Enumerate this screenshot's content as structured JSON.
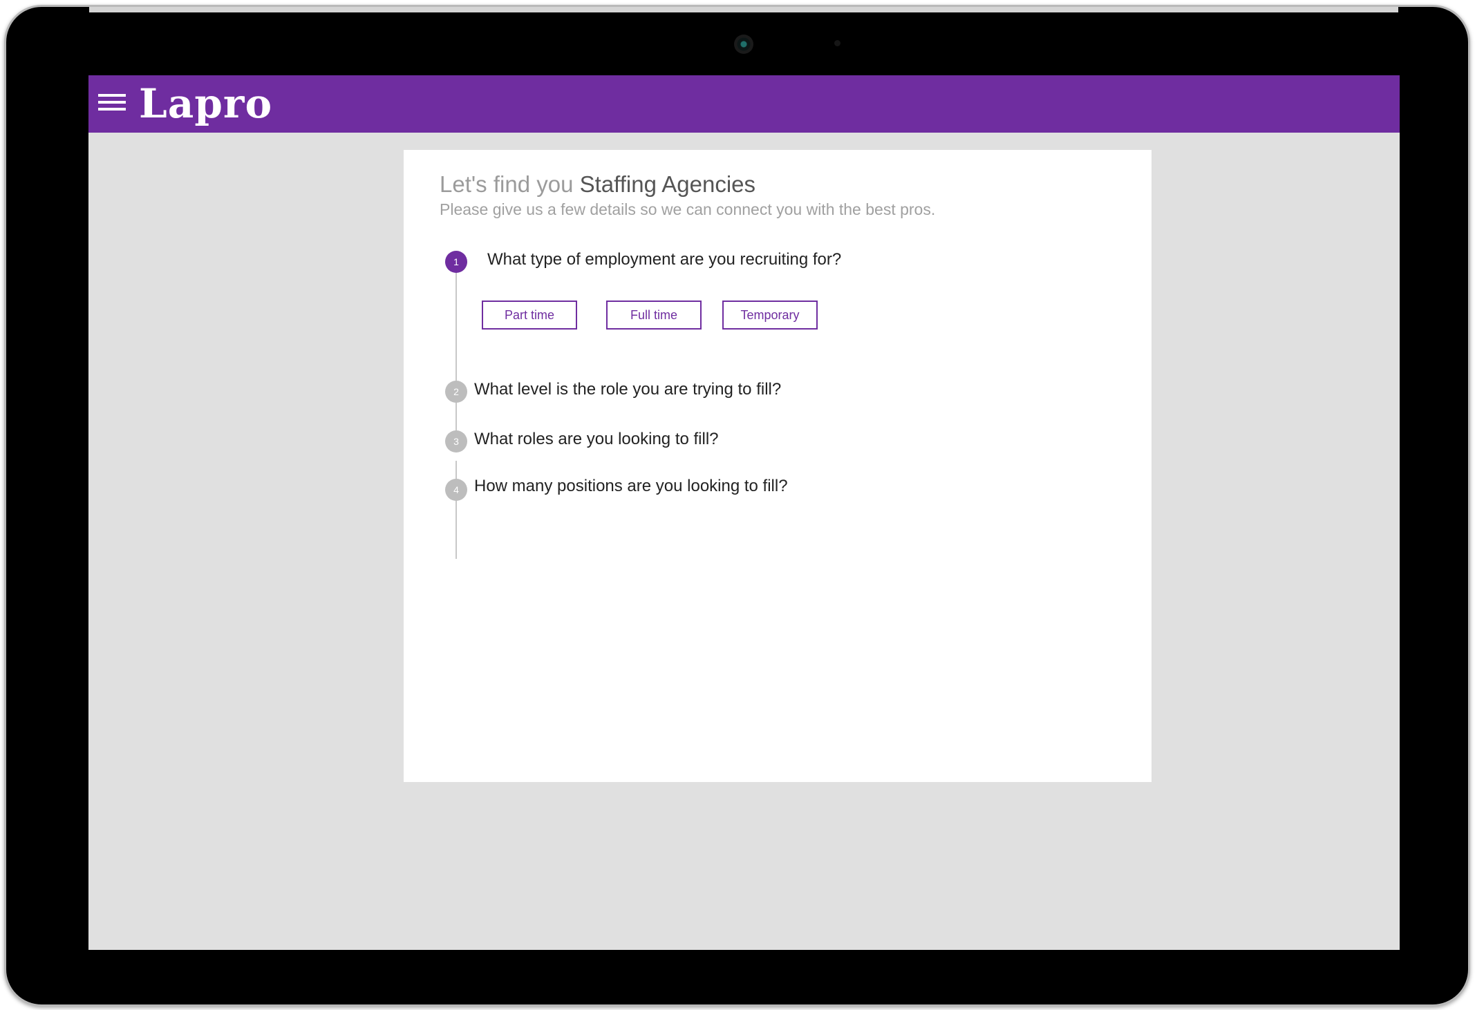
{
  "app": {
    "brand": "Lapro",
    "brand_color": "#6f2da0"
  },
  "header": {
    "title_prefix": "Let's find you",
    "title_category": "Staffing Agencies",
    "subtitle": "Please give us a few details so we can connect you with the best pros."
  },
  "steps": [
    {
      "number": "1",
      "question": "What type of employment are you recruiting for?",
      "state": "active",
      "options": [
        "Part time",
        "Full time",
        "Temporary"
      ]
    },
    {
      "number": "2",
      "question": "What level is the role you are trying to fill?",
      "state": "inactive"
    },
    {
      "number": "3",
      "question": "What roles are you looking to fill?",
      "state": "inactive"
    },
    {
      "number": "4",
      "question": "How many positions are you looking to fill?",
      "state": "inactive"
    }
  ],
  "icons": {
    "menu": "hamburger-menu-icon",
    "camera": "front-camera-icon"
  }
}
